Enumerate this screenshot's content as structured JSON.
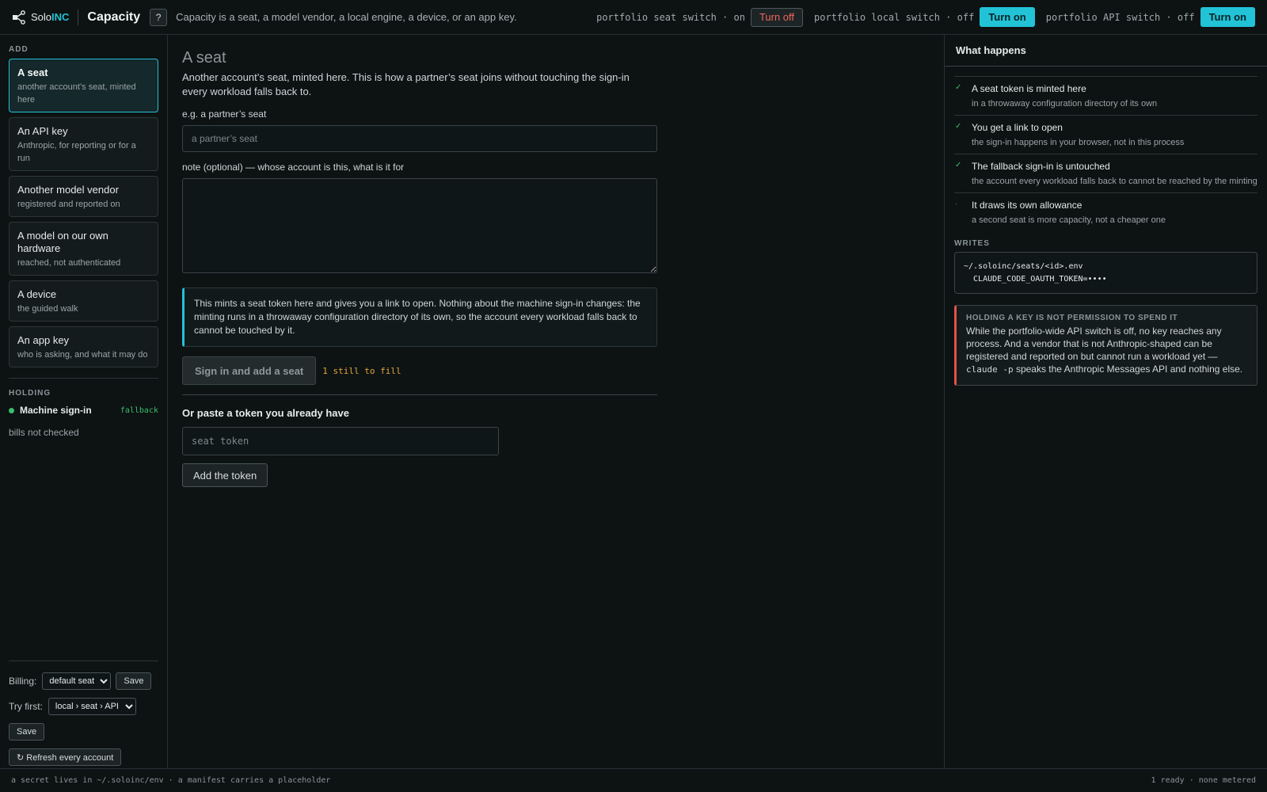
{
  "header": {
    "brand_prefix": "Solo",
    "brand_suffix": "INC",
    "logo_icon": "network-nodes-icon",
    "title": "Capacity",
    "help_label": "?",
    "description": "Capacity is a seat, a model vendor, a local engine, a device, or an app key.",
    "switches": [
      {
        "label": "portfolio seat switch · on",
        "button": "Turn off"
      },
      {
        "label": "portfolio local switch · off",
        "button": "Turn on"
      },
      {
        "label": "portfolio API switch · off",
        "button": "Turn on"
      }
    ]
  },
  "sidebar": {
    "add_label": "ADD",
    "items": [
      {
        "title": "A seat",
        "sub": "another account’s seat, minted here"
      },
      {
        "title": "An API key",
        "sub": "Anthropic, for reporting or for a run"
      },
      {
        "title": "Another model vendor",
        "sub": "registered and reported on"
      },
      {
        "title": "A model on our own hardware",
        "sub": "reached, not authenticated"
      },
      {
        "title": "A device",
        "sub": "the guided walk"
      },
      {
        "title": "An app key",
        "sub": "who is asking, and what it may do"
      }
    ],
    "holding_label": "HOLDING",
    "holding": {
      "name": "Machine sign-in",
      "tag": "fallback"
    },
    "bills": "bills not checked",
    "billing_label": "Billing:",
    "billing_value": "default seat",
    "billing_save": "Save",
    "try_first_label": "Try first:",
    "try_first_value": "local › seat › API",
    "try_first_save": "Save",
    "refresh_icon": "↻",
    "refresh_label": "Refresh every account"
  },
  "main": {
    "title": "A seat",
    "description": "Another account’s seat, minted here. This is how a partner’s seat joins without touching the sign-in every workload falls back to.",
    "name_label": "e.g. a partner’s seat",
    "name_placeholder": "a partner’s seat",
    "note_label": "note (optional) — whose account is this, what is it for",
    "info": "This mints a seat token here and gives you a link to open. Nothing about the machine sign-in changes: the minting runs in a throwaway configuration directory of its own, so the account every workload falls back to cannot be touched by it.",
    "submit_label": "Sign in and add a seat",
    "todo": "1 still to fill",
    "paste_title": "Or paste a token you already have",
    "token_placeholder": "seat token",
    "add_token_label": "Add the token"
  },
  "right": {
    "title": "What happens",
    "steps": [
      {
        "check": "✓",
        "title": "A seat token is minted here",
        "sub": "in a throwaway configuration directory of its own"
      },
      {
        "check": "✓",
        "title": "You get a link to open",
        "sub": "the sign-in happens in your browser, not in this process"
      },
      {
        "check": "✓",
        "title": "The fallback sign-in is untouched",
        "sub": "the account every workload falls back to cannot be reached by the minting"
      },
      {
        "check": "·",
        "title": "It draws its own allowance",
        "sub": "a second seat is more capacity, not a cheaper one"
      }
    ],
    "writes_label": "WRITES",
    "writes_line1": "~/.soloinc/seats/<id>.env",
    "writes_line2": "  CLAUDE_CODE_OAUTH_TOKEN=••••",
    "warn_title": "HOLDING A KEY IS NOT PERMISSION TO SPEND IT",
    "warn_body_1": "While the portfolio-wide API switch is off, no key reaches any process. And a vendor that is not Anthropic-shaped can be registered and reported on but cannot run a workload yet — ",
    "warn_code": "claude -p",
    "warn_body_2": " speaks the Anthropic Messages API and nothing else."
  },
  "footer": {
    "left": "a secret lives in ~/.soloinc/env · a manifest carries a placeholder",
    "right": "1 ready · none metered"
  },
  "colors": {
    "accent": "#22c3d6",
    "danger": "#f0665a",
    "success": "#3bbf6a",
    "warning": "#e0a93a"
  }
}
